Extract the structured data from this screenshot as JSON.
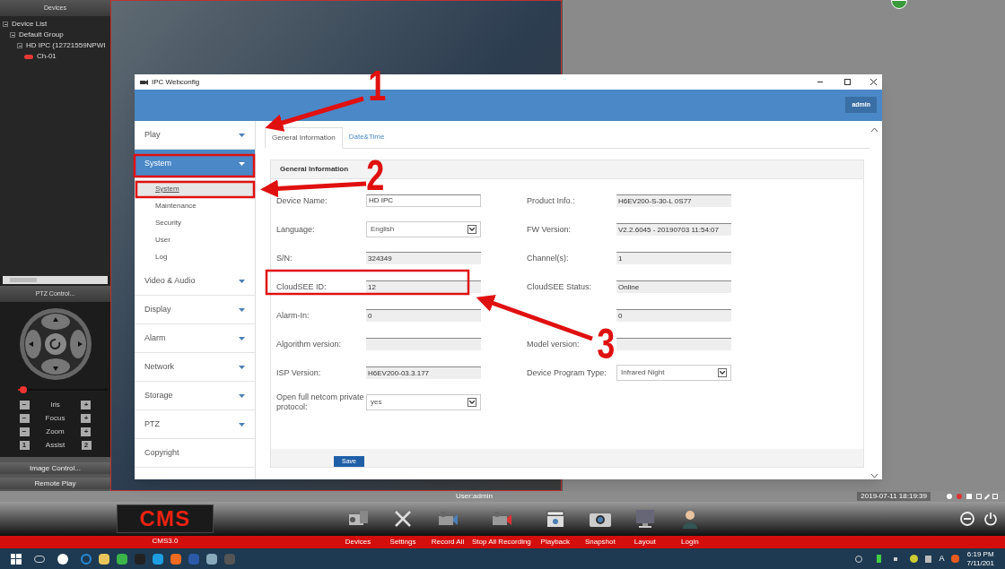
{
  "devices_panel": {
    "title": "Devices",
    "tree": [
      {
        "label": "Device List",
        "children": [
          {
            "label": "Default Group",
            "children": [
              {
                "label": "HD IPC (12721559NPWI",
                "children": [
                  {
                    "label": "Ch-01"
                  }
                ]
              }
            ]
          }
        ]
      }
    ]
  },
  "ptz_panel": {
    "title": "PTZ Control...",
    "speed": {
      "level": 0.06
    },
    "rows": [
      {
        "label": "Iris",
        "minus": "−",
        "plus": "+"
      },
      {
        "label": "Focus",
        "minus": "−",
        "plus": "+"
      },
      {
        "label": "Zoom",
        "minus": "−",
        "plus": "+"
      },
      {
        "label": "Assist",
        "minus": "1",
        "plus": "2"
      }
    ],
    "buttons": [
      "Image Control...",
      "Remote Play"
    ]
  },
  "dialog": {
    "title": "IPC Webconfig",
    "user": "admin",
    "menu": [
      {
        "label": "Play",
        "selected": false,
        "expandable": true
      },
      {
        "label": "System",
        "selected": true,
        "expandable": true,
        "children": [
          {
            "label": "System",
            "selected": true
          },
          {
            "label": "Maintenance",
            "selected": false
          },
          {
            "label": "Security",
            "selected": false
          },
          {
            "label": "User",
            "selected": false
          },
          {
            "label": "Log",
            "selected": false
          }
        ]
      },
      {
        "label": "Video & Audio",
        "selected": false,
        "expandable": true
      },
      {
        "label": "Display",
        "selected": false,
        "expandable": true
      },
      {
        "label": "Alarm",
        "selected": false,
        "expandable": true
      },
      {
        "label": "Network",
        "selected": false,
        "expandable": true
      },
      {
        "label": "Storage",
        "selected": false,
        "expandable": true
      },
      {
        "label": "PTZ",
        "selected": false,
        "expandable": true
      },
      {
        "label": "Copyright",
        "selected": false,
        "expandable": false
      }
    ],
    "tabs": [
      {
        "label": "General Information",
        "selected": true
      },
      {
        "label": "Date&Time",
        "selected": false
      }
    ],
    "section_title": "General Information",
    "rows": [
      {
        "left": {
          "label": "Device Name:",
          "value": "HD IPC",
          "kind": "text"
        },
        "right": {
          "label": "Product Info.:",
          "value": "H6EV200-S-30-L 0S77",
          "kind": "readonly"
        }
      },
      {
        "left": {
          "label": "Language:",
          "value": "English",
          "kind": "select"
        },
        "right": {
          "label": "FW Version:",
          "value": "V2.2.6045 - 20190703 11:54:07",
          "kind": "readonly"
        }
      },
      {
        "left": {
          "label": "S/N:",
          "value": "324349",
          "kind": "readonly"
        },
        "right": {
          "label": "Channel(s):",
          "value": "1",
          "kind": "readonly"
        }
      },
      {
        "left": {
          "label": "CloudSEE ID:",
          "value": "12",
          "kind": "readonly"
        },
        "right": {
          "label": "CloudSEE Status:",
          "value": "Online",
          "kind": "readonly"
        }
      },
      {
        "left": {
          "label": "Alarm-In:",
          "value": "0",
          "kind": "readonly"
        },
        "right": {
          "value": "0",
          "kind": "readonly"
        }
      },
      {
        "left": {
          "label": "Algorithm version:",
          "kind": "readonly"
        },
        "right": {
          "label": "Model version:",
          "kind": "readonly"
        }
      },
      {
        "left": {
          "label": "ISP Version:",
          "value": "H6EV200-03.3.177",
          "kind": "readonly"
        },
        "right": {
          "label": "Device Program Type:",
          "value": "Infrared Night",
          "kind": "select"
        }
      },
      {
        "left": {
          "label": "Open full netcom private protocol:",
          "value": "yes",
          "kind": "select"
        }
      }
    ],
    "save": "Save"
  },
  "annotations": [
    "1",
    "2",
    "3"
  ],
  "status_bar": {
    "user": "User:admin",
    "datetime": "2019-07-11 18:19:39"
  },
  "toolbar": {
    "logo": "CMS",
    "version": "CMS3.0",
    "buttons": [
      {
        "label": "Devices",
        "kind": "devices"
      },
      {
        "label": "Settings",
        "kind": "settings"
      },
      {
        "label": "Record All",
        "kind": "record"
      },
      {
        "label": "Stop All Recording",
        "kind": "stop"
      },
      {
        "label": "Playback",
        "kind": "playback"
      },
      {
        "label": "Snapshot",
        "kind": "snapshot"
      },
      {
        "label": "Layout",
        "kind": "layout"
      },
      {
        "label": "Login",
        "kind": "login"
      }
    ]
  },
  "taskbar": {
    "tray_letter": "A",
    "time": "6:19 PM",
    "date": "7/11/201"
  }
}
